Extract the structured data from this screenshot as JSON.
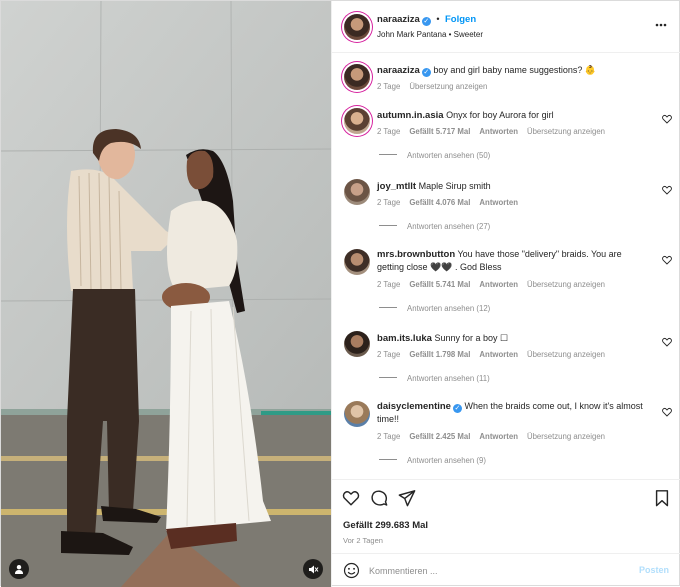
{
  "header": {
    "username": "naraaziza",
    "separator": "•",
    "follow_label": "Folgen",
    "subtitle": "John Mark Pantana • Sweeter",
    "more_icon": "more-horizontal-icon"
  },
  "caption": {
    "username": "naraaziza",
    "text": "boy and girl baby name suggestions? 👶",
    "age": "2 Tage",
    "translate": "Übersetzung anzeigen"
  },
  "comments": [
    {
      "username": "autumn.in.asia",
      "text": "Onyx for boy Aurora for girl",
      "age": "2 Tage",
      "likes": "Gefällt 5.717 Mal",
      "reply": "Antworten",
      "translate": "Übersetzung anzeigen",
      "view_replies": "Antworten ansehen (50)"
    },
    {
      "username": "joy_mtllt",
      "text": "Maple Sirup smith",
      "age": "2 Tage",
      "likes": "Gefällt 4.076 Mal",
      "reply": "Antworten",
      "translate": "",
      "view_replies": "Antworten ansehen (27)"
    },
    {
      "username": "mrs.brownbutton",
      "text": "You have those \"delivery\" braids. You are getting close 🖤🖤 . God Bless",
      "age": "2 Tage",
      "likes": "Gefällt 5.741 Mal",
      "reply": "Antworten",
      "translate": "Übersetzung anzeigen",
      "view_replies": "Antworten ansehen (12)"
    },
    {
      "username": "bam.its.luka",
      "text": "Sunny for a boy ☐",
      "age": "2 Tage",
      "likes": "Gefällt 1.798 Mal",
      "reply": "Antworten",
      "translate": "Übersetzung anzeigen",
      "view_replies": "Antworten ansehen (11)"
    },
    {
      "username": "daisyclementine",
      "text": "When the braids come out, I know it's almost time!!",
      "age": "2 Tage",
      "likes": "Gefällt 2.425 Mal",
      "reply": "Antworten",
      "translate": "Übersetzung anzeigen",
      "view_replies": "Antworten ansehen (9)"
    }
  ],
  "actions": {
    "likes": "Gefällt 299.683 Mal",
    "posted": "Vor 2 Tagen"
  },
  "add_comment": {
    "placeholder": "Kommentieren ...",
    "post_label": "Posten"
  },
  "colors": {
    "accent": "#0095f6",
    "muted": "#8e8e8e",
    "verified": "#3897f0"
  }
}
